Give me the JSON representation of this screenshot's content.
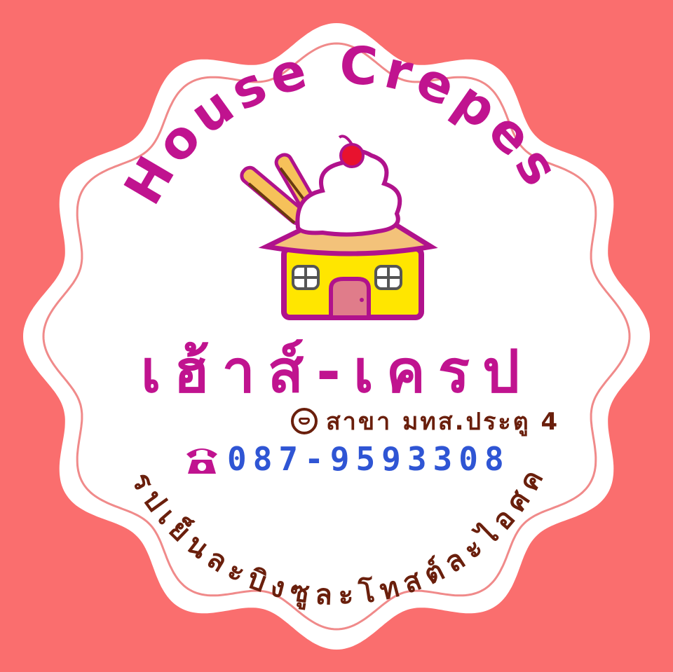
{
  "logo": {
    "english_title": "House Crepes",
    "thai_name": "เฮ้าส์-เครป",
    "branch": "สาขา มทส.ประตู 4",
    "branch_icon": "location-icon",
    "phone": "087-9593308",
    "phone_icon": "telephone-icon",
    "tagline": "เครปเย็นละบิงซูละโทสต์ละไอศครีม"
  },
  "colors": {
    "background": "#fa6e6e",
    "badge_fill": "#ffffff",
    "badge_border": "#f08a8a",
    "title_magenta": "#c0138f",
    "tagline_brown": "#6a1f0c",
    "phone_blue": "#2f55d4",
    "house_yellow": "#ffe600",
    "house_outline": "#b0128c"
  }
}
